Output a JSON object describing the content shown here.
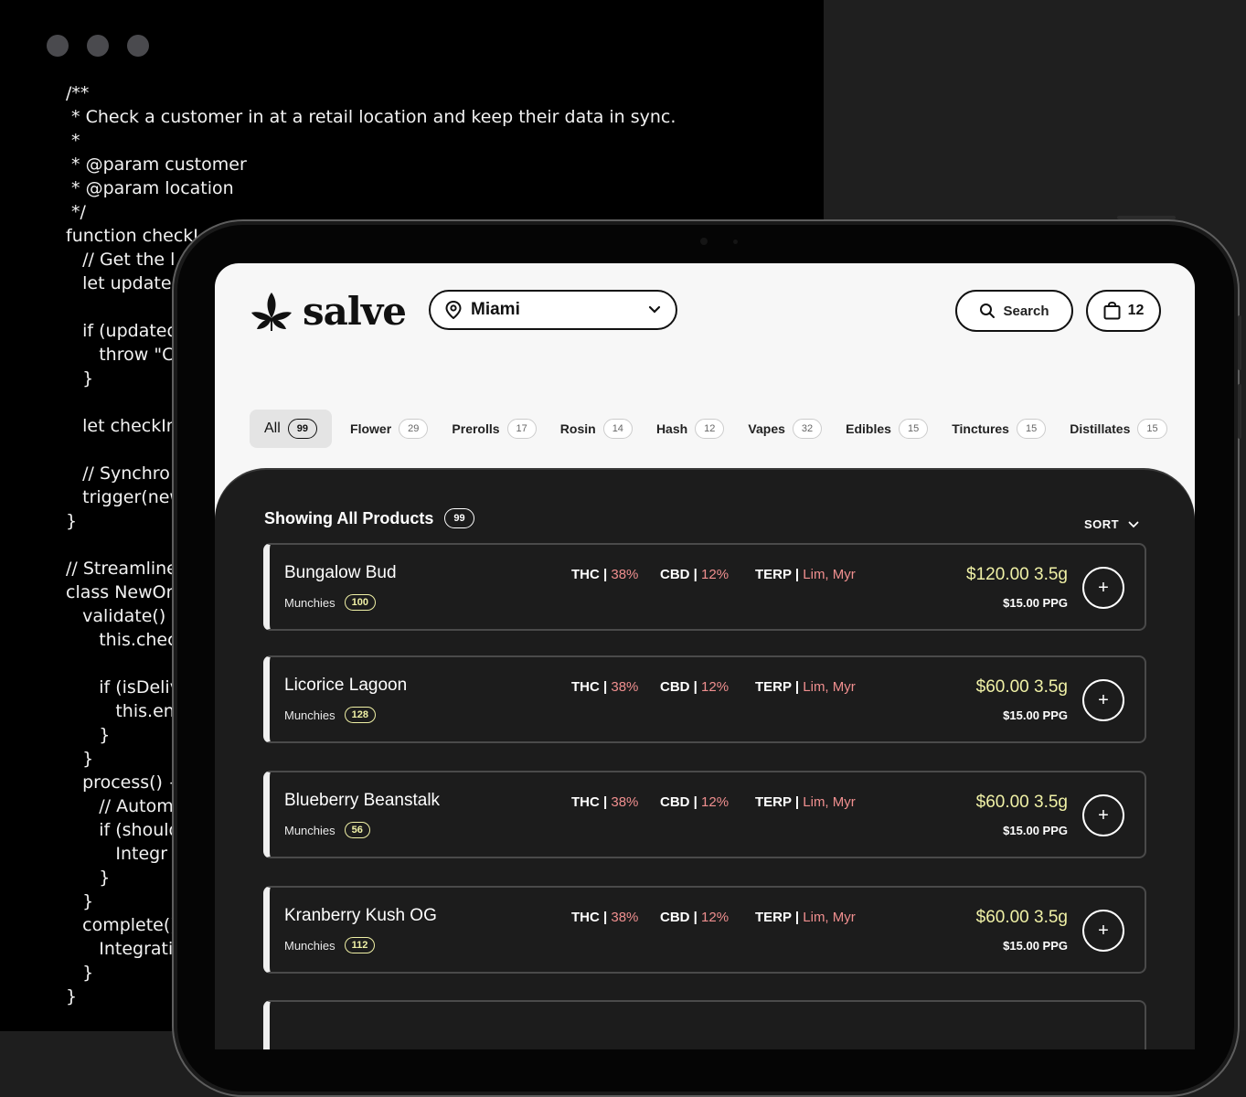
{
  "code_window": {
    "lines": [
      "/**",
      " * Check a customer in at a retail location and keep their data in sync.",
      " *",
      " * @param customer",
      " * @param location",
      " */",
      "function checkI",
      "   // Get the l",
      "   let updated",
      "",
      "   if (updated",
      "      throw \"C",
      "   }",
      "",
      "   let checkIn",
      "",
      "   // Synchro",
      "   trigger(new",
      "}",
      "",
      "// Streamline",
      "class NewOrd",
      "   validate() {",
      "      this.chec",
      "",
      "      if (isDeliv",
      "         this.en",
      "      }",
      "   }",
      "   process() {",
      "      // Autom",
      "      if (should",
      "         Integr",
      "      }",
      "   }",
      "   complete()",
      "      Integrati",
      "   }",
      "}"
    ]
  },
  "header": {
    "logo_text": "salve",
    "location": "Miami",
    "search_label": "Search",
    "cart_count": "12"
  },
  "categories": [
    {
      "name": "All",
      "count": "99"
    },
    {
      "name": "Flower",
      "count": "29"
    },
    {
      "name": "Prerolls",
      "count": "17"
    },
    {
      "name": "Rosin",
      "count": "14"
    },
    {
      "name": "Hash",
      "count": "12"
    },
    {
      "name": "Vapes",
      "count": "32"
    },
    {
      "name": "Edibles",
      "count": "15"
    },
    {
      "name": "Tinctures",
      "count": "15"
    },
    {
      "name": "Distillates",
      "count": "15"
    }
  ],
  "listing": {
    "title": "Showing All Products",
    "count": "99",
    "sort_label": "SORT"
  },
  "products": [
    {
      "name": "Bungalow Bud",
      "brand": "Munchies",
      "stock": "100",
      "thc_label": "THC | ",
      "thc": "38%",
      "cbd_label": "CBD | ",
      "cbd": "12%",
      "terp_label": "TERP | ",
      "terp": "Lim, Myr",
      "price": "$120.00 3.5g",
      "ppg": "$15.00 PPG",
      "add": "+"
    },
    {
      "name": "Licorice Lagoon",
      "brand": "Munchies",
      "stock": "128",
      "thc_label": "THC | ",
      "thc": "38%",
      "cbd_label": "CBD | ",
      "cbd": "12%",
      "terp_label": "TERP | ",
      "terp": "Lim, Myr",
      "price": "$60.00 3.5g",
      "ppg": "$15.00 PPG",
      "add": "+"
    },
    {
      "name": "Blueberry Beanstalk",
      "brand": "Munchies",
      "stock": "56",
      "thc_label": "THC | ",
      "thc": "38%",
      "cbd_label": "CBD | ",
      "cbd": "12%",
      "terp_label": "TERP | ",
      "terp": "Lim, Myr",
      "price": "$60.00 3.5g",
      "ppg": "$15.00 PPG",
      "add": "+"
    },
    {
      "name": "Kranberry Kush OG",
      "brand": "Munchies",
      "stock": "112",
      "thc_label": "THC | ",
      "thc": "38%",
      "cbd_label": "CBD | ",
      "cbd": "12%",
      "terp_label": "TERP | ",
      "terp": "Lim, Myr",
      "price": "$60.00 3.5g",
      "ppg": "$15.00 PPG",
      "add": "+"
    }
  ],
  "colors": {
    "price": "#f0f1a6",
    "stat_value": "#f08f8f",
    "panel": "#1c1c1c"
  }
}
